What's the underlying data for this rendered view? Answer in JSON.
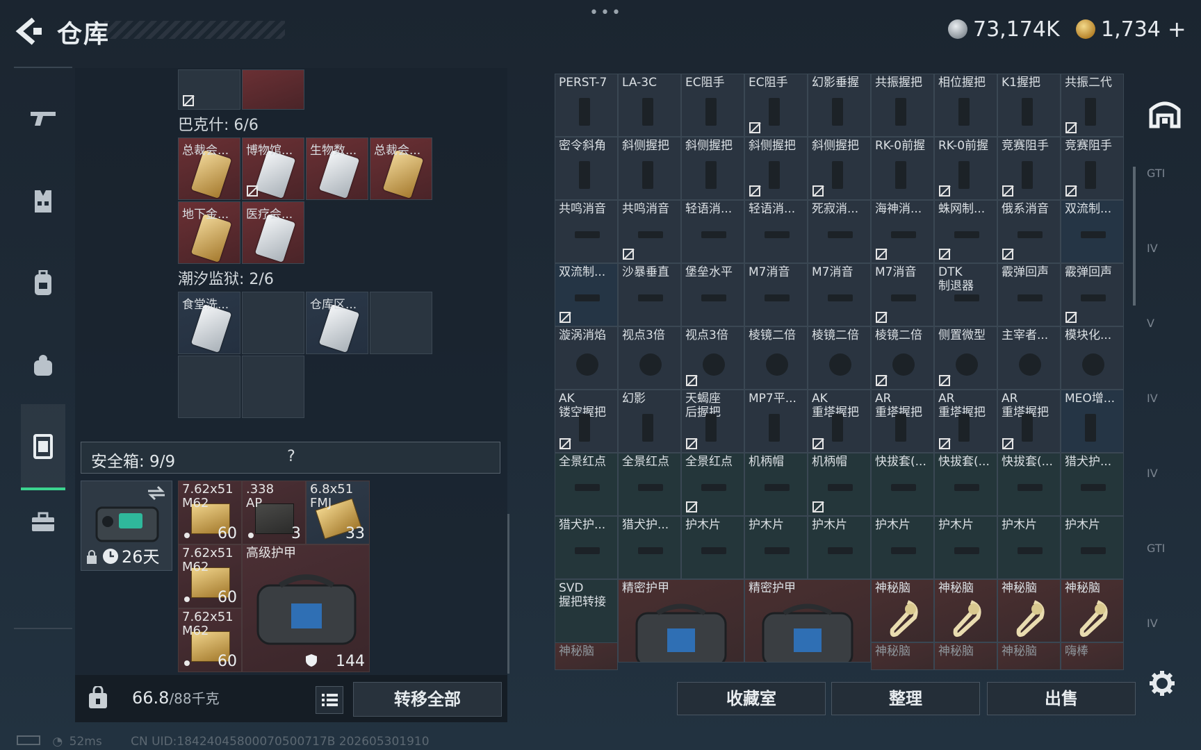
{
  "header": {
    "title": "仓库",
    "menu_dots": "•••",
    "currency_silver": "73,174K",
    "currency_gold": "1,734",
    "currency_plus": "+"
  },
  "left": {
    "bakesh_label": "巴克什: 6/6",
    "bakesh_cards": [
      {
        "label": "总裁会..."
      },
      {
        "label": "博物馆..."
      },
      {
        "label": "生物数..."
      },
      {
        "label": "总裁会..."
      },
      {
        "label": "地下金..."
      },
      {
        "label": "医疗会..."
      }
    ],
    "tide_label": "潮汐监狱: 2/6",
    "tide_cards": [
      {
        "label": "食堂洗..."
      },
      {
        "label": "仓库区..."
      }
    ],
    "safebox_title": "安全箱: 9/9",
    "safebox_help": "?",
    "safebox_days": "26天",
    "ammo": [
      {
        "name": "7.62x51\nM62",
        "count": "60"
      },
      {
        "name": ".338\nAP",
        "count": "3"
      },
      {
        "name": "6.8x51\nFMJ",
        "count": "33"
      },
      {
        "name": "7.62x51\nM62",
        "count": "60"
      },
      {
        "name": "7.62x51\nM62",
        "count": "60"
      }
    ],
    "armor_bag_label": "高级护甲",
    "armor_bag_count": "144",
    "weight_value": "66.8",
    "weight_max": "/88千克",
    "transfer_all": "转移全部"
  },
  "grid": {
    "rows": [
      [
        "PERST-7",
        "LA-3C",
        "EC阻手",
        "EC阻手",
        "幻影垂握",
        "共振握把",
        "相位握把",
        "K1握把",
        "共振二代"
      ],
      [
        "密令斜角",
        "斜侧握把",
        "斜侧握把",
        "斜侧握把",
        "斜侧握把",
        "RK-0前握",
        "RK-0前握",
        "竞赛阻手",
        "竞赛阻手"
      ],
      [
        "共鸣消音",
        "共鸣消音",
        "轻语消...",
        "轻语消...",
        "死寂消...",
        "海神消...",
        "蛛网制...",
        "俄系消音",
        "双流制..."
      ],
      [
        "双流制...",
        "沙暴垂直",
        "堡垒水平",
        "M7消音",
        "M7消音",
        "M7消音",
        "DTK\n制退器",
        "霰弹回声",
        "霰弹回声"
      ],
      [
        "漩涡消焰",
        "视点3倍",
        "视点3倍",
        "棱镜二倍",
        "棱镜二倍",
        "棱镜二倍",
        "侧置微型",
        "主宰者...",
        "模块化..."
      ],
      [
        "AK\n镂空握把",
        "幻影",
        "天蝎座\n后握把",
        "MP7平...",
        "AK\n重塔握把",
        "AR\n重塔握把",
        "AR\n重塔握把",
        "AR\n重塔握把",
        "MEO增..."
      ],
      [
        "全景红点",
        "全景红点",
        "全景红点",
        "机柄帽",
        "机柄帽",
        "快拔套(...",
        "快拔套(...",
        "快拔套(...",
        "猎犬护..."
      ],
      [
        "猎犬护...",
        "猎犬护...",
        "护木片",
        "护木片",
        "护木片",
        "护木片",
        "护木片",
        "护木片",
        "护木片"
      ]
    ],
    "last_row": {
      "svd": "SVD\n握把转接",
      "bag1": "精密护甲",
      "bag2": "精密护甲",
      "mystery": [
        "神秘脑",
        "神秘脑",
        "神秘脑",
        "神秘脑"
      ],
      "bottom_partial": [
        "神秘脑",
        "神秘脑",
        "神秘脑",
        "神秘脑",
        "嗨棒"
      ]
    }
  },
  "buttons": {
    "collection": "收藏室",
    "organize": "整理",
    "sell": "出售"
  },
  "rail": {
    "labels": [
      "GTI",
      "IV",
      "V",
      "IV",
      "IV",
      "GTI",
      "IV"
    ]
  },
  "status": {
    "ping": "52ms",
    "uid": "CN UID:18424045800070500717B 202605301910"
  }
}
